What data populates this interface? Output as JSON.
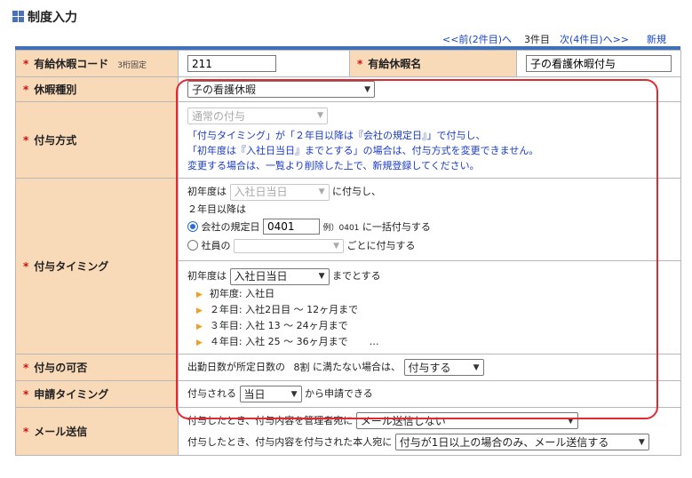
{
  "header": {
    "title": "制度入力"
  },
  "nav": {
    "prev": "<<前(2件目)へ",
    "current": "3件目",
    "next": "次(4件目)へ>>",
    "new": "新規"
  },
  "fields": {
    "code": {
      "label": "有給休暇コード",
      "hint": "3桁固定",
      "value": "211"
    },
    "name": {
      "label": "有給休暇名",
      "value": "子の看護休暇付与"
    },
    "type": {
      "label": "休暇種別",
      "value": "子の看護休暇"
    },
    "method": {
      "label": "付与方式",
      "value": "通常の付与",
      "note1": "「付与タイミング」が「２年目以降は『会社の規定日』」で付与し、",
      "note2": "「初年度は『入社日当日』までとする」の場合は、付与方式を変更できません。",
      "note3": "変更する場合は、一覧より削除した上で、新規登録してください。"
    },
    "timing": {
      "label": "付与タイミング",
      "first_prefix": "初年度は",
      "first_value": "入社日当日",
      "first_suffix": "に付与し、",
      "second_year": "２年目以降は",
      "opt1_label": "会社の規定日",
      "opt1_value": "0401",
      "opt1_example": "例）0401",
      "opt1_suffix": "に一括付与する",
      "opt2_label": "社員の",
      "opt2_value": "",
      "opt2_suffix": "ごとに付与する",
      "until_prefix": "初年度は",
      "until_value": "入社日当日",
      "until_suffix": "までとする",
      "bullets": [
        "初年度:  入社日",
        "２年目:  入社2日目 〜 12ヶ月まで",
        "３年目:  入社 13 〜 24ヶ月まで",
        "４年目:  入社 25 〜 36ヶ月まで"
      ],
      "ellipsis": "…"
    },
    "eligibility": {
      "label": "付与の可否",
      "text": "出勤日数が所定日数の",
      "ratio": "8割",
      "suffix": "に満たない場合は、",
      "value": "付与する"
    },
    "apply": {
      "label": "申請タイミング",
      "prefix": "付与される",
      "value": "当日",
      "suffix": "から申請できる"
    },
    "mail": {
      "label": "メール送信",
      "admin_text": "付与したとき、付与内容を管理者宛に",
      "admin_value": "メール送信しない",
      "user_text": "付与したとき、付与内容を付与された本人宛に",
      "user_value": "付与が1日以上の場合のみ、メール送信する"
    }
  },
  "colors": {
    "label_bg": "#f8d9b8",
    "accent": "#4070b8",
    "required": "#d01010",
    "note": "#1a3cc8",
    "frame": "#e22a35"
  }
}
